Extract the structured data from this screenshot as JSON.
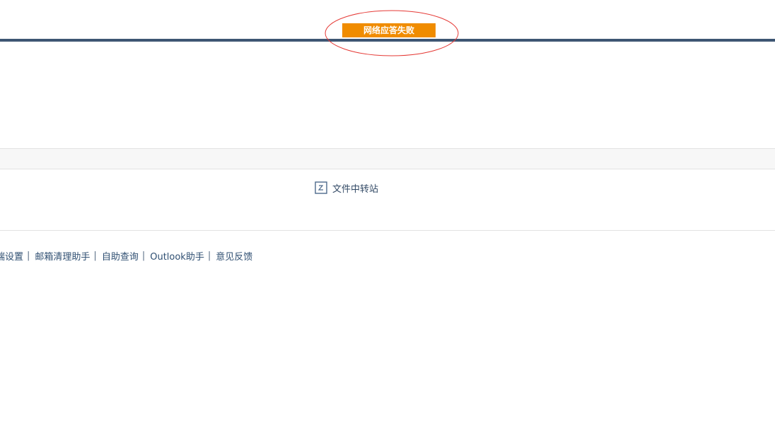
{
  "toast": {
    "message": "网络应答失败",
    "color": "#f08c00"
  },
  "header": {
    "bar_color": "#3e5673"
  },
  "file_transfer": {
    "icon": "file-transfer-icon",
    "label": "文件中转站"
  },
  "footer": {
    "links": [
      "端设置",
      "邮箱清理助手",
      "自助查询",
      "Outlook助手",
      "意见反馈"
    ],
    "separator": "|"
  }
}
